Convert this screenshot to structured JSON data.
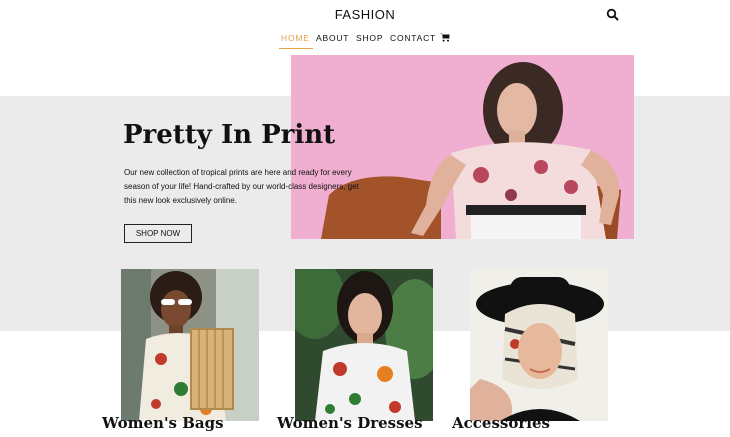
{
  "header": {
    "logo": "FASHION",
    "search_icon": "search-icon",
    "cart_icon": "cart-icon"
  },
  "nav": {
    "items": [
      {
        "label": "HOME",
        "active": true
      },
      {
        "label": "ABOUT",
        "active": false
      },
      {
        "label": "SHOP",
        "active": false
      },
      {
        "label": "CONTACT",
        "active": false
      }
    ]
  },
  "hero": {
    "title": "Pretty In Print",
    "text": "Our new collection of tropical prints are here and ready for every season of your life! Hand-crafted by our world-class designers, get this new look exclusively online.",
    "button_label": "SHOP NOW"
  },
  "categories": [
    {
      "label": "Women's Bags"
    },
    {
      "label": "Women's Dresses"
    },
    {
      "label": "Accessories"
    }
  ],
  "colors": {
    "accent": "#e4a24a",
    "hero_band": "#ebebeb",
    "hero_image_bg": "#f0aed0"
  }
}
